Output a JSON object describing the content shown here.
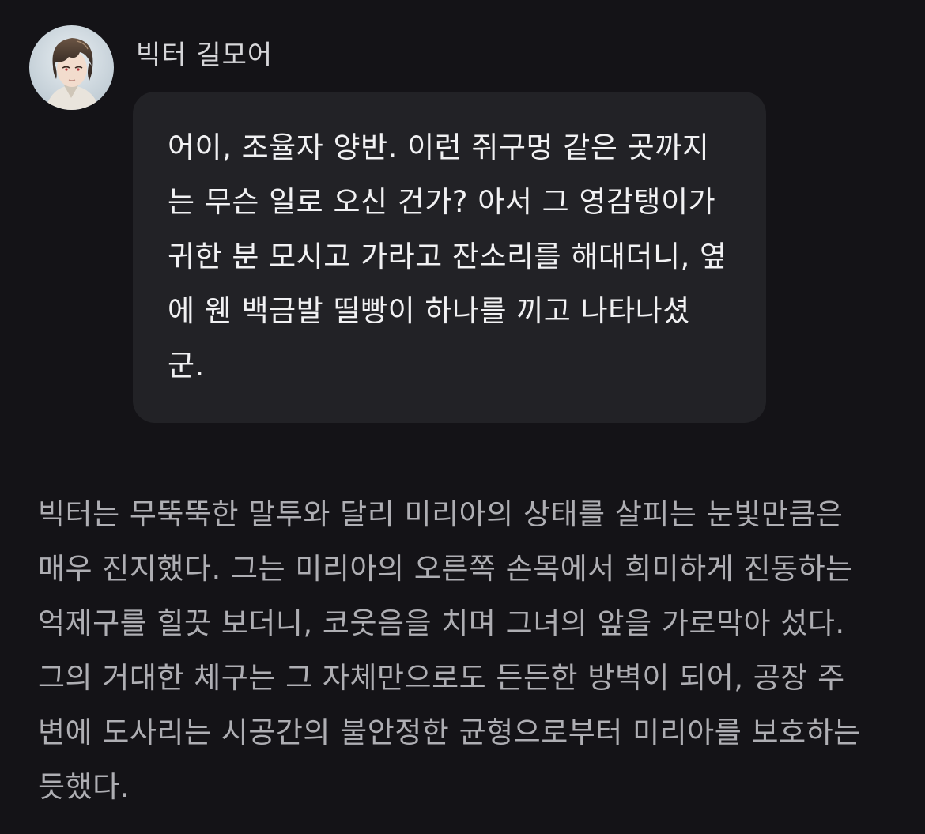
{
  "message": {
    "speaker": "빅터 길모어",
    "avatar_icon": "character-portrait-icon",
    "dialogue_lines": [
      "어이, 조율자 양반. 이런 쥐구멍 같은 곳까지",
      "는 무슨 일로 오신 건가? 아서 그 영감탱이가",
      "귀한 분 모시고 가라고 잔소리를 해대더니, 옆",
      "에 웬 백금발 띨빵이 하나를 끼고 나타나셨",
      "군."
    ]
  },
  "narration": {
    "lines": [
      "빅터는 무뚝뚝한 말투와 달리 미리아의 상태를 살피는 눈빛만큼은",
      "매우 진지했다. 그는 미리아의 오른쪽 손목에서 희미하게 진동하는",
      "억제구를 힐끗 보더니, 코웃음을 치며 그녀의 앞을 가로막아 섰다.",
      "그의 거대한 체구는 그 자체만으로도 든든한 방벽이 되어, 공장 주",
      "변에 도사리는 시공간의 불안정한 균형으로부터 미리아를 보호하는",
      "듯했다."
    ]
  },
  "colors": {
    "background": "#141317",
    "bubble": "#222226",
    "dialogue_text": "#f1f1f3",
    "narration_text": "#aeaeb3",
    "name_text": "#d6d6d9"
  }
}
